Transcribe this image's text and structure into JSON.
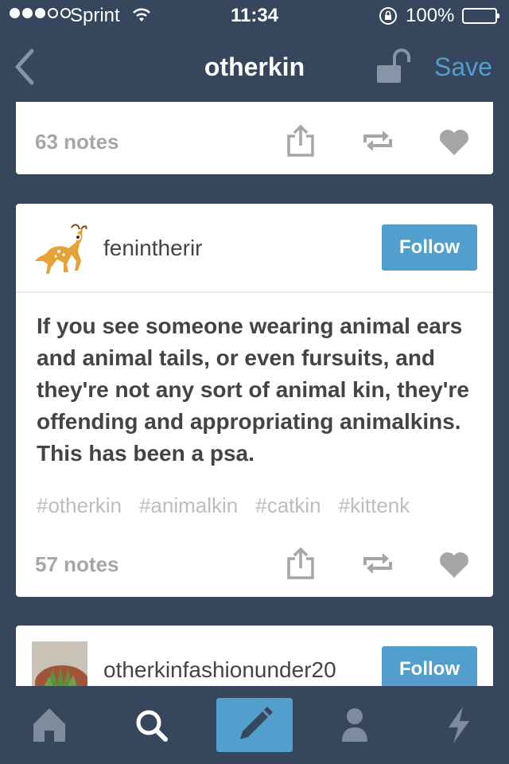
{
  "status_bar": {
    "carrier": "Sprint",
    "time": "11:34",
    "battery": "100%"
  },
  "nav": {
    "title": "otherkin",
    "save_label": "Save"
  },
  "posts": [
    {
      "notes": "63 notes"
    },
    {
      "blog": "fenintherir",
      "follow_label": "Follow",
      "text": "If you see someone wearing animal ears and animal tails, or even fursuits, and they're not any sort of animal kin, they're offending and appropriating animalkins. This has been a psa.",
      "tags": [
        "#otherkin",
        "#animalkin",
        "#catkin",
        "#kittenk"
      ],
      "notes": "57 notes"
    },
    {
      "blog": "otherkinfashionunder20",
      "follow_label": "Follow"
    }
  ],
  "colors": {
    "background": "#36465d",
    "accent": "#529ecc",
    "icon_gray": "#a6a6a6"
  },
  "tab_bar": {
    "tabs": [
      "home-icon",
      "search-icon",
      "compose-icon",
      "account-icon",
      "activity-icon"
    ],
    "selected": "compose-icon"
  }
}
